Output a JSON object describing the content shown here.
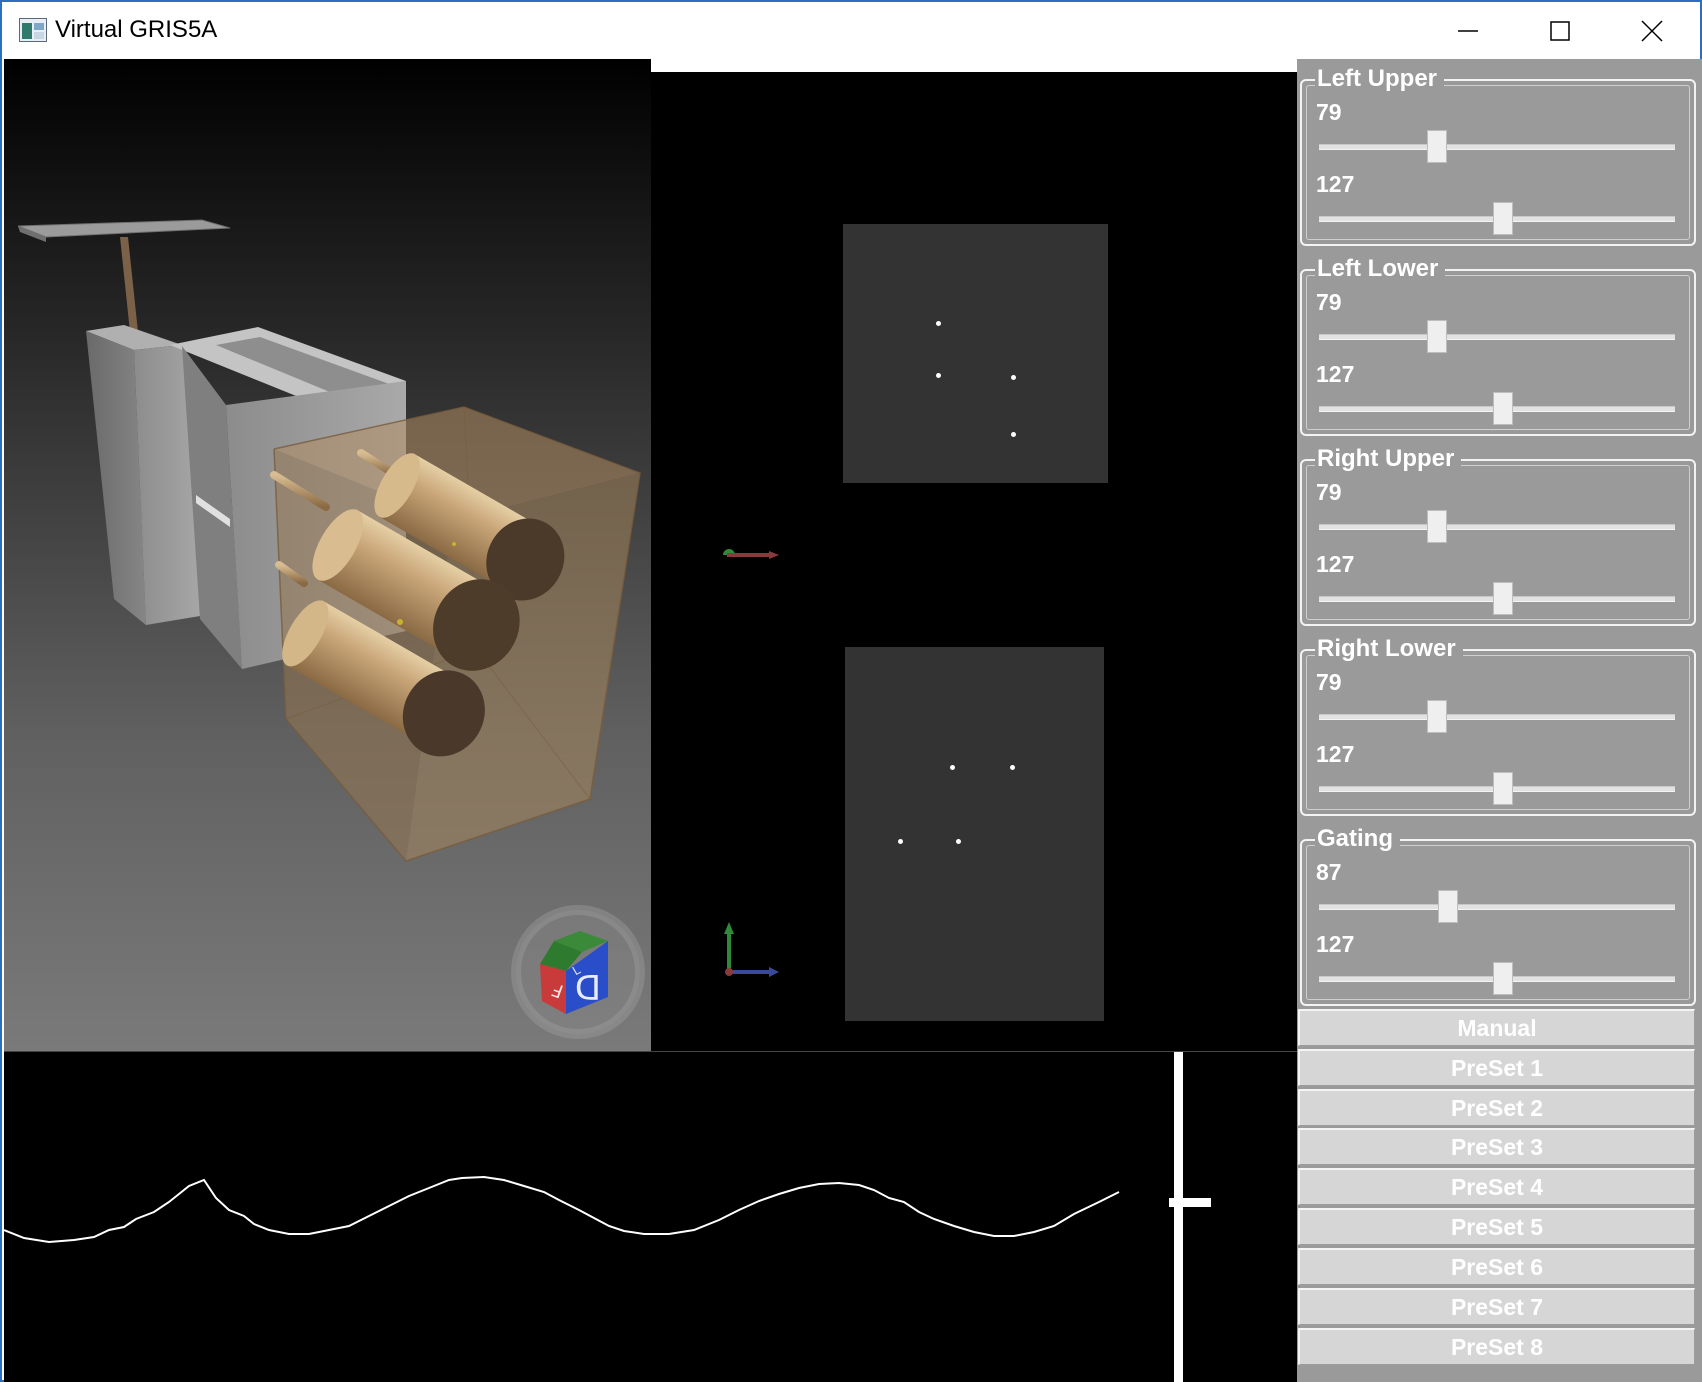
{
  "window": {
    "title": "Virtual GRIS5A",
    "buttons": {
      "minimize": "minimize-icon",
      "maximize": "maximize-icon",
      "close": "close-icon"
    }
  },
  "controls": {
    "groups": [
      {
        "title": "Left Upper",
        "value1": "79",
        "value2": "127",
        "slider1": 79,
        "slider2": 127
      },
      {
        "title": "Left Lower",
        "value1": "79",
        "value2": "127",
        "slider1": 79,
        "slider2": 127
      },
      {
        "title": "Right Upper",
        "value1": "79",
        "value2": "127",
        "slider1": 79,
        "slider2": 127
      },
      {
        "title": "Right Lower",
        "value1": "79",
        "value2": "127",
        "slider1": 79,
        "slider2": 127
      },
      {
        "title": "Gating",
        "value1": "87",
        "value2": "127",
        "slider1": 87,
        "slider2": 127
      }
    ],
    "slider_max": 255,
    "buttons": [
      "Manual",
      "PreSet 1",
      "PreSet 2",
      "PreSet 3",
      "PreSet 4",
      "PreSet 5",
      "PreSet 6",
      "PreSet 7",
      "PreSet 8"
    ]
  },
  "orientation_cube": {
    "faces": [
      "F",
      "L",
      "D"
    ]
  },
  "colors": {
    "panel_gray": "#9a9a9a",
    "detector_gray": "#333333",
    "copper": "#b08d62",
    "axis_x": "#8a3a3a",
    "axis_y": "#2f8a3a",
    "axis_z": "#3a4a9a"
  }
}
